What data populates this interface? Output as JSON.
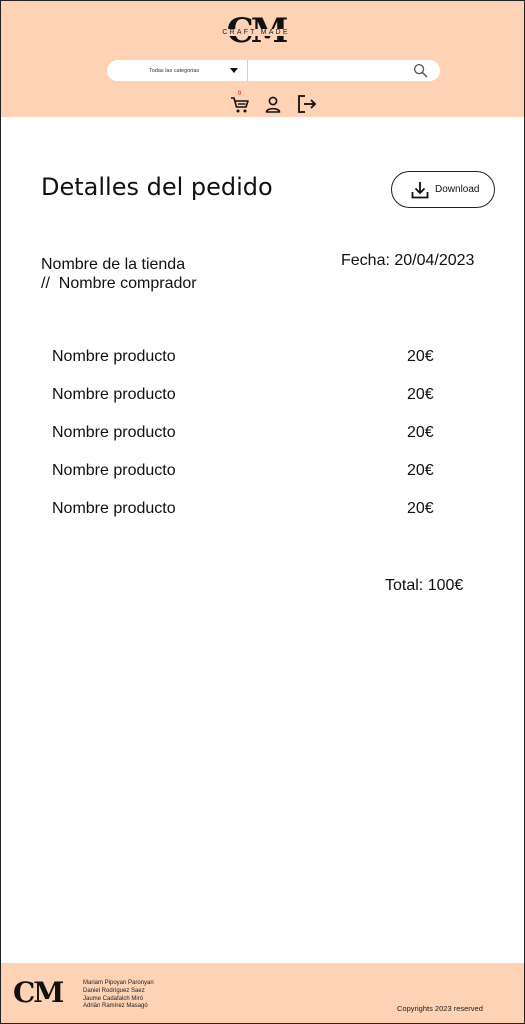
{
  "header": {
    "logo_mark": "CM",
    "logo_text": "CRAFT MADE",
    "search": {
      "category_selected": "Todas las categorias",
      "placeholder": ""
    },
    "cart_count": "0"
  },
  "main": {
    "title": "Detalles del pedido",
    "download_label": "Download",
    "store_name": "Nombre de la tienda",
    "buyer_line": "//  Nombre comprador",
    "date": "Fecha: 20/04/2023",
    "items": [
      {
        "name": "Nombre producto",
        "price": "20€"
      },
      {
        "name": "Nombre producto",
        "price": "20€"
      },
      {
        "name": "Nombre producto",
        "price": "20€"
      },
      {
        "name": "Nombre producto",
        "price": "20€"
      },
      {
        "name": "Nombre producto",
        "price": "20€"
      }
    ],
    "total": "Total: 100€"
  },
  "footer": {
    "logo_mark": "CM",
    "authors": [
      "Mariam Pipoyan Paronyan",
      "Daniel Rodríguez Saez",
      "Jaume Cadafalch Miró",
      "Adrián Ramírez Masagó"
    ],
    "copyright": "Copyrights 2023 reserved"
  },
  "colors": {
    "header_bg": "#fdd2b5",
    "footer_bg": "#fdd2b5",
    "badge": "#e0542b"
  },
  "icons": [
    "search-icon",
    "cart-icon",
    "user-icon",
    "logout-icon",
    "download-icon"
  ]
}
